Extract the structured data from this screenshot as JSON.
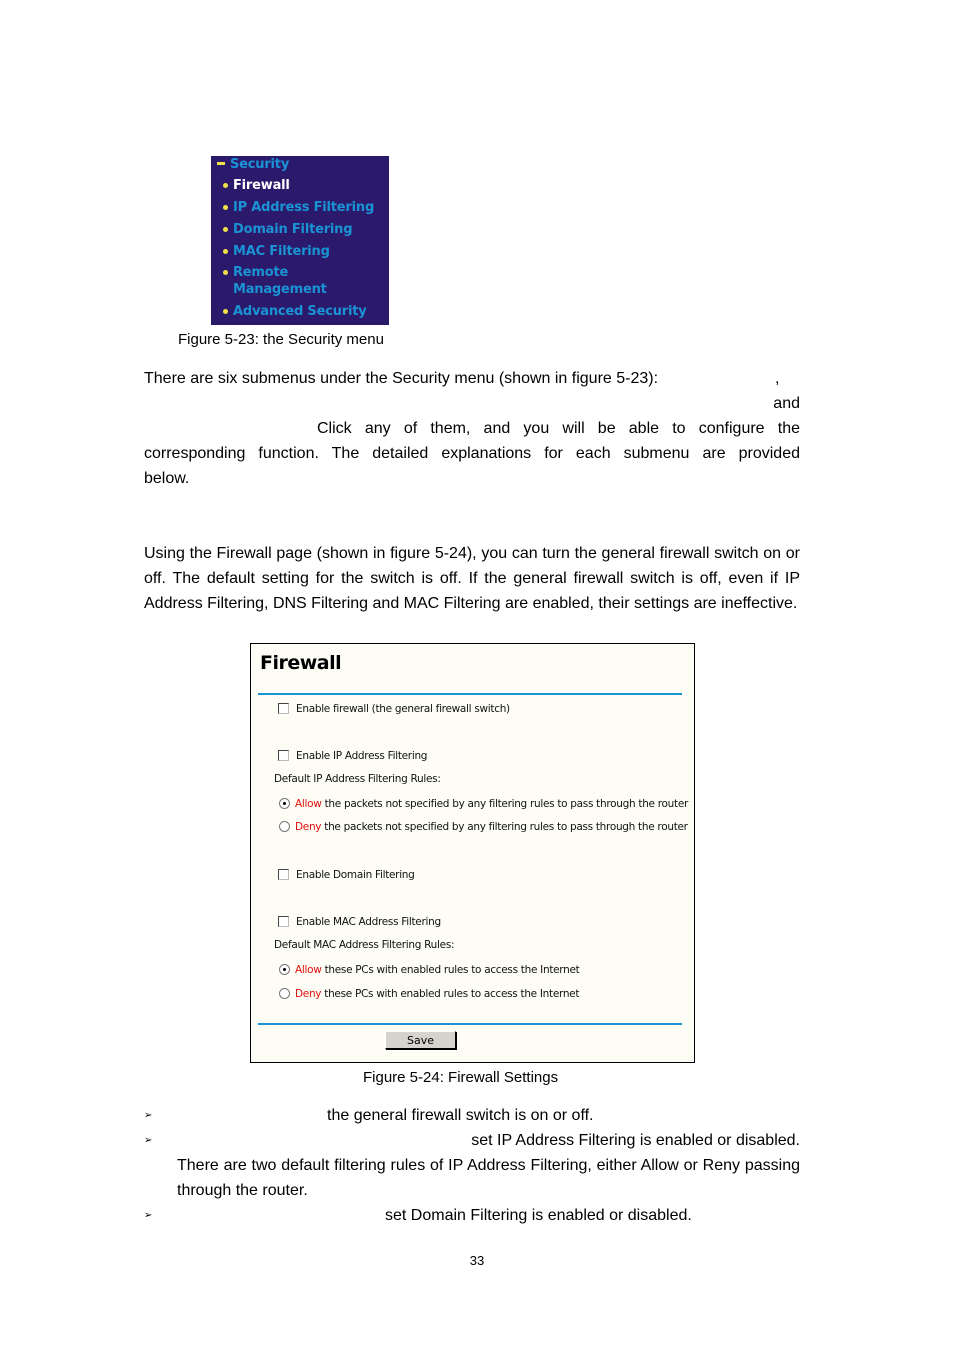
{
  "security_menu": {
    "header": "Security",
    "items": [
      {
        "label": "Firewall",
        "active": true
      },
      {
        "label": "IP Address Filtering",
        "active": false
      },
      {
        "label": "Domain Filtering",
        "active": false
      },
      {
        "label": "MAC Filtering",
        "active": false
      },
      {
        "label": "Remote",
        "label2": "Management",
        "active": false
      },
      {
        "label": "Advanced Security",
        "active": false
      }
    ],
    "colors": {
      "background": "#2b1a6b",
      "link": "#1a93d4",
      "active": "#ffffff",
      "bullet": "#f0e04a"
    }
  },
  "figure_5_23_caption": "Figure 5-23: the Security menu",
  "intro_paragraph": {
    "line1": "There are six submenus under the Security menu (shown in figure 5-23):",
    "line1_tail": ",",
    "line2": "and",
    "line3": "Click any of them, and you will be able to configure the",
    "line4": "corresponding function. The detailed explanations for each submenu are provided",
    "line5": "below."
  },
  "firewall_paragraph": "Using the Firewall page (shown in figure 5-24), you can turn the general firewall switch on or off. The default setting for the switch is off. If the general firewall switch is off, even if IP Address Filtering, DNS Filtering and MAC Filtering are enabled, their settings are ineffective.",
  "firewall_panel": {
    "title": "Firewall",
    "enable_firewall": {
      "label": "Enable firewall (the general firewall switch)",
      "checked": false
    },
    "enable_ip_filtering": {
      "label": "Enable IP Address Filtering",
      "checked": false
    },
    "ip_rules_label": "Default IP Address Filtering Rules:",
    "ip_rules": [
      {
        "keyword": "Allow",
        "text": "the packets not specified by any filtering rules to pass through the router",
        "selected": true
      },
      {
        "keyword": "Deny",
        "text": "the packets not specified by any filtering rules to pass through the router",
        "selected": false
      }
    ],
    "enable_domain_filtering": {
      "label": "Enable Domain Filtering",
      "checked": false
    },
    "enable_mac_filtering": {
      "label": "Enable MAC Address Filtering",
      "checked": false
    },
    "mac_rules_label": "Default MAC Address Filtering Rules:",
    "mac_rules": [
      {
        "keyword": "Allow",
        "text": "these PCs with enabled rules to access the Internet",
        "selected": true
      },
      {
        "keyword": "Deny",
        "text": "these PCs with enabled rules to access the Internet",
        "selected": false
      }
    ],
    "save_label": "Save",
    "colors": {
      "rule": "#1a93d4",
      "keyword": "#e01010",
      "background": "#fdfdf5"
    }
  },
  "figure_5_24_caption": "Figure 5-24: Firewall Settings",
  "bullets": [
    {
      "text": "the general firewall switch is on or off."
    },
    {
      "text": "set IP Address Filtering is enabled or disabled.",
      "continuation": "There are two default filtering rules of IP Address Filtering, either Allow or Reny passing through the router."
    },
    {
      "text": "set Domain Filtering is enabled or disabled."
    }
  ],
  "bullet_glyph": "➢",
  "page_number": "33"
}
